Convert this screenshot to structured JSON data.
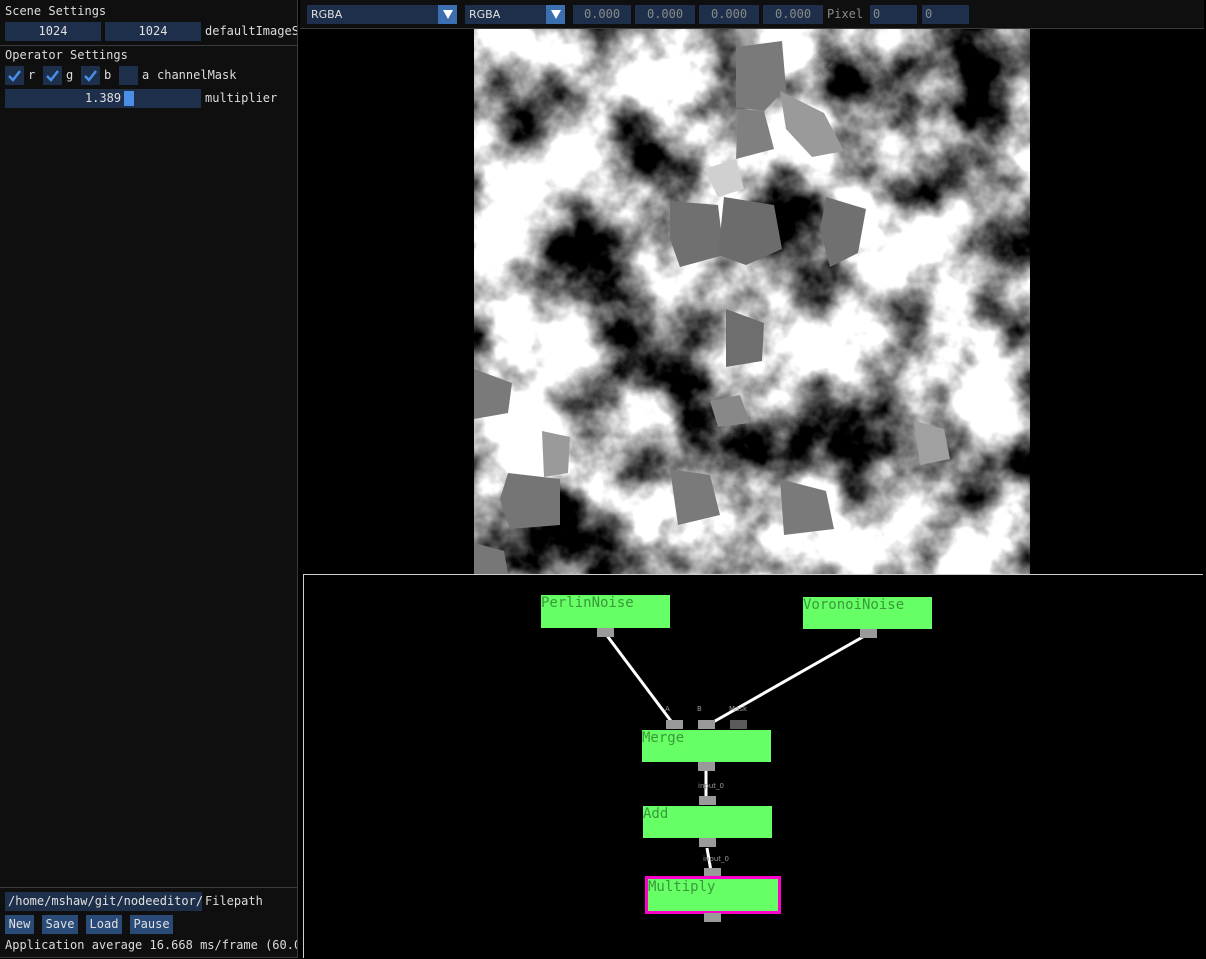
{
  "scene_settings": {
    "title": "Scene Settings",
    "width_value": "1024",
    "height_value": "1024",
    "size_label": "defaultImageS"
  },
  "operator_settings": {
    "title": "Operator Settings",
    "channels": [
      {
        "label": "r",
        "checked": true
      },
      {
        "label": "g",
        "checked": true
      },
      {
        "label": "b",
        "checked": true
      },
      {
        "label": "a",
        "checked": false
      }
    ],
    "channel_mask_label": "channelMask",
    "multiplier_value": "1.389",
    "multiplier_label": "multiplier"
  },
  "file": {
    "path_value": "/home/mshaw/git/nodeeditor/.",
    "path_label": "Filepath",
    "buttons": {
      "new": "New",
      "save": "Save",
      "load": "Load",
      "pause": "Pause"
    }
  },
  "status": {
    "text": "Application average 16.668 ms/frame (60.0"
  },
  "toolbar": {
    "format_a": "RGBA",
    "format_b": "RGBA",
    "values": [
      "0.000",
      "0.000",
      "0.000",
      "0.000"
    ],
    "pixel_label": "Pixel",
    "pixel_x": "0",
    "pixel_y": "0"
  },
  "node_editor": {
    "nodes": {
      "perlin": "PerlinNoise",
      "voronoi": "VoronoiNoise",
      "merge": "Merge",
      "add": "Add",
      "multiply": "Multiply"
    },
    "pin_labels": {
      "merge_in_a": "A",
      "merge_in_b": "B",
      "merge_in_mask": "Mask",
      "add_in": "input_0",
      "multiply_in": "input_0"
    },
    "selected_node": "Multiply",
    "node_color": "#66ff66",
    "selection_color": "#ff00cc"
  },
  "colors": {
    "panel_bg": "#0f0f0f",
    "field_bg": "#1d2f4a",
    "accent": "#4a8ee8",
    "button_bg": "#2a4a78"
  }
}
